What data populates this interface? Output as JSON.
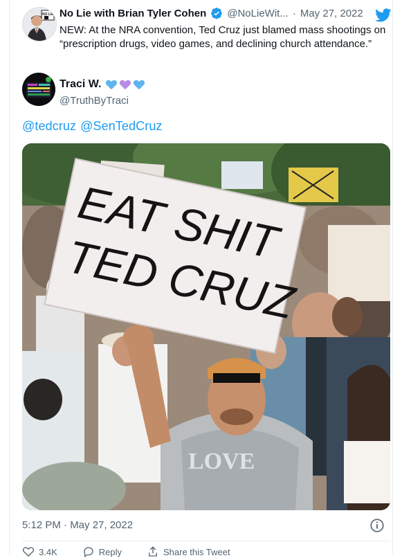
{
  "top_tweet": {
    "name": "No Lie with Brian Tyler Cohen",
    "handle": "@NoLieWit...",
    "separator": "·",
    "date": "May 27, 2022",
    "text": "NEW: At the NRA convention, Ted Cruz just blamed mass shootings on “prescription drugs, video games, and declining church attendance.”"
  },
  "main_tweet": {
    "author_name": "Traci W.",
    "author_handle": "@TruthByTraci",
    "mentions": [
      "@tedcruz",
      "@SenTedCruz"
    ],
    "sign_text_line1": "EAT SHIT",
    "sign_text_line2": "TED CRUZ",
    "shirt_text": "LOVE",
    "timestamp": "5:12 PM · May 27, 2022"
  },
  "actions": {
    "likes": "3.4K",
    "reply": "Reply",
    "share": "Share this Tweet"
  },
  "colors": {
    "link": "#1d9bf0",
    "secondary": "#536471",
    "heart1": "#5fb3ef",
    "heart2": "#b88be6",
    "heart3": "#5fb3ef"
  },
  "icons": [
    "verified-badge-icon",
    "twitter-bird-icon",
    "heart-icon",
    "info-icon",
    "reply-icon",
    "share-icon",
    "like-icon"
  ]
}
